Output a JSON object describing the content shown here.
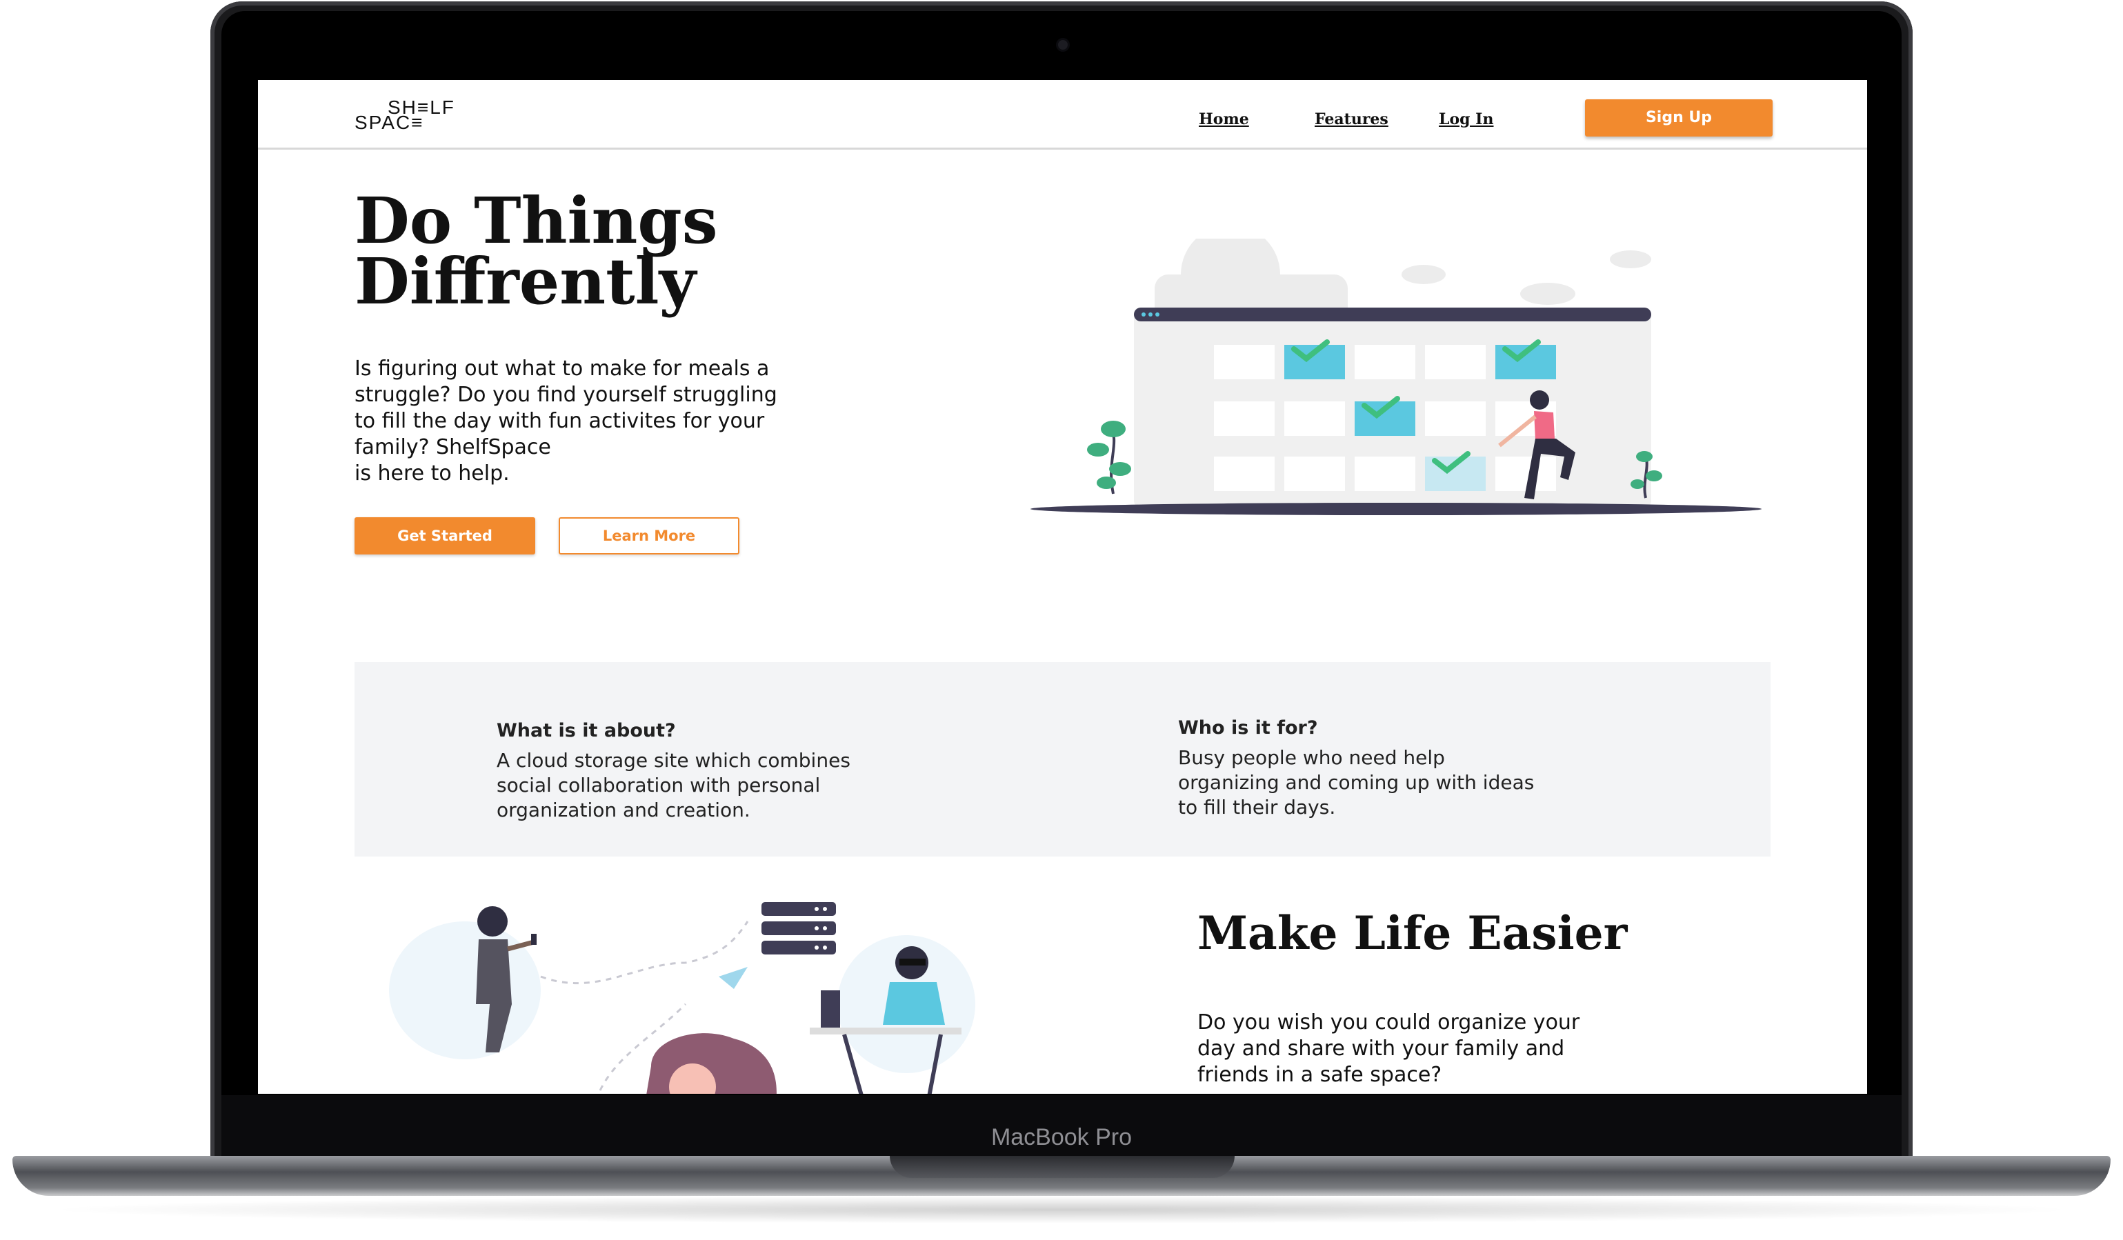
{
  "device": {
    "brand_label": "MacBook Pro"
  },
  "nav": {
    "logo_top": "SH≡LF",
    "logo_bottom": "SPAC≡",
    "links": [
      "Home",
      "Features",
      "Log In"
    ],
    "signup_label": "Sign Up"
  },
  "hero": {
    "title_line1": "Do Things",
    "title_line2": "Diffrently",
    "body_lines": [
      "Is figuring out what to make for meals a",
      "struggle? Do you find yourself struggling",
      "to fill the day with fun activites for your",
      "family? ShelfSpace",
      "is here to help."
    ],
    "primary_button": "Get Started",
    "secondary_button": "Learn More"
  },
  "info": {
    "left": {
      "heading": "What is it about?",
      "lines": [
        "A cloud storage site which combines",
        "social collaboration with personal",
        "organization and creation."
      ]
    },
    "right": {
      "heading": "Who is it for?",
      "lines": [
        "Busy people who need help",
        "organizing and coming up with ideas",
        "to fill their days."
      ]
    }
  },
  "feature": {
    "title": "Make Life Easier",
    "lines": [
      "Do you wish you could organize your",
      "day and share with your family and",
      "friends in a safe space?"
    ]
  },
  "colors": {
    "accent": "#f28a2e",
    "teal": "#5bc8e0",
    "check": "#3fbf7f",
    "pink": "#f06a86"
  }
}
